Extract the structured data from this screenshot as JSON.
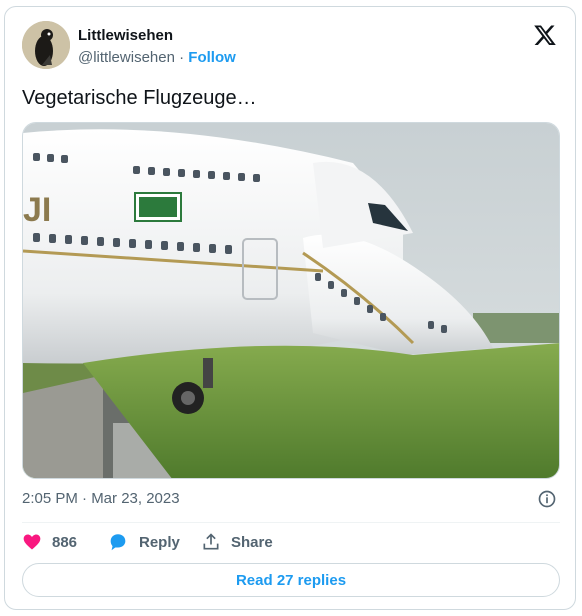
{
  "author": {
    "name": "Littlewisehen",
    "handle": "@littlewisehen",
    "separator": "·",
    "follow_label": "Follow"
  },
  "tweet": {
    "text": "Vegetarische Flugzeuge…"
  },
  "media": {
    "aircraft_text": "JI"
  },
  "meta": {
    "timestamp": "2:05 PM · Mar 23, 2023"
  },
  "actions": {
    "likes_count": "886",
    "reply_label": "Reply",
    "share_label": "Share"
  },
  "read_replies_label": "Read 27 replies",
  "colors": {
    "brand_blue": "#1d9bf0",
    "heart_pink": "#f91880",
    "muted_text": "#536471"
  },
  "icons": [
    "x-logo-icon",
    "info-icon",
    "heart-icon",
    "reply-bubble-icon",
    "share-icon"
  ]
}
